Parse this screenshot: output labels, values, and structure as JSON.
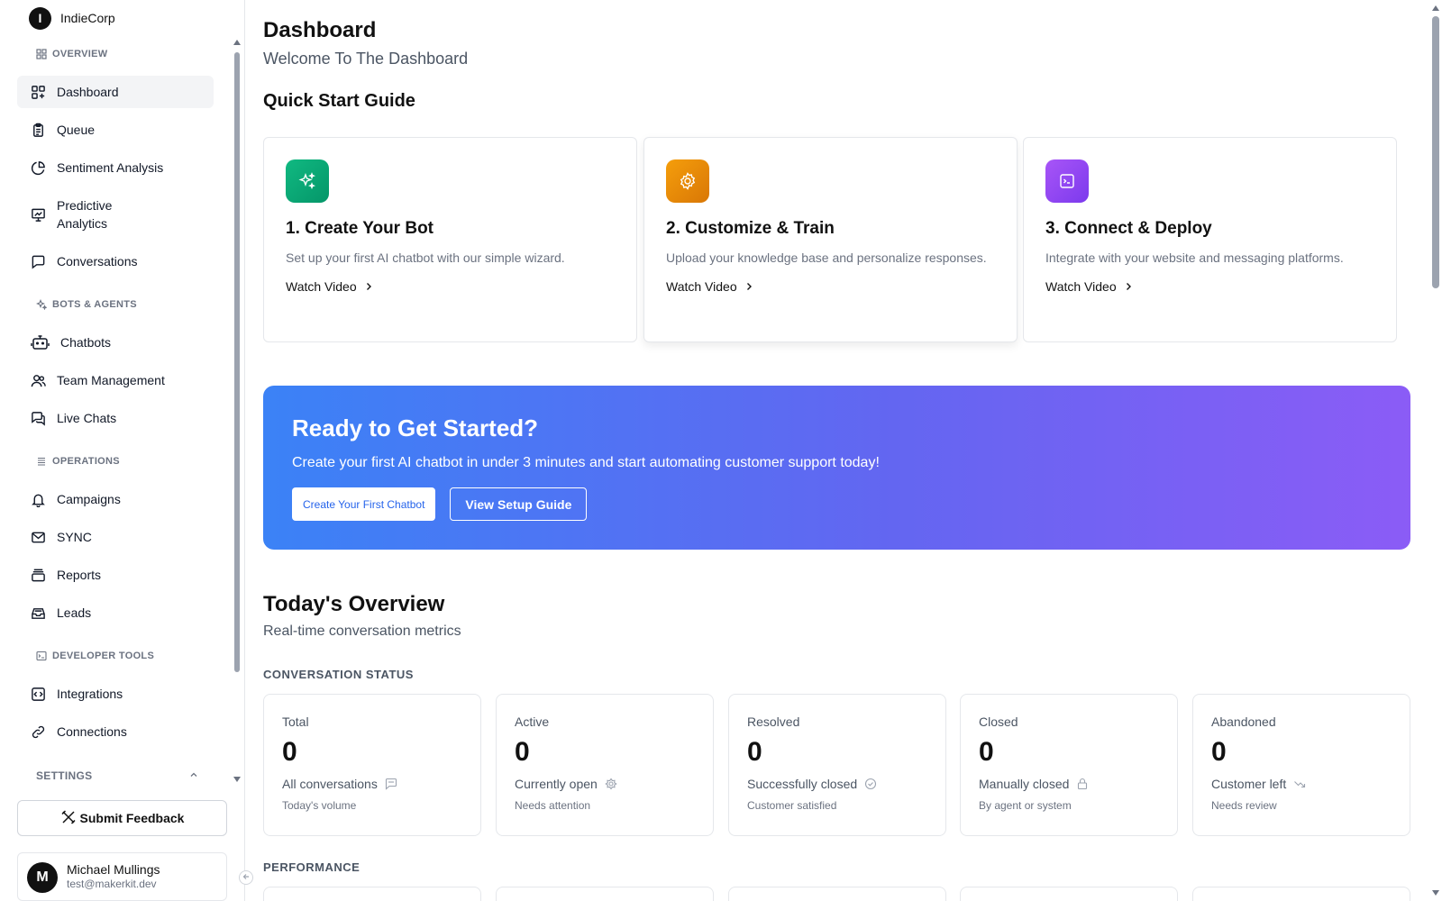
{
  "brand": {
    "logo_letter": "I",
    "name": "IndieCorp"
  },
  "sidebar": {
    "sections": {
      "overview": "OVERVIEW",
      "bots_agents": "BOTS & AGENTS",
      "operations": "OPERATIONS",
      "developer_tools": "DEVELOPER TOOLS",
      "settings": "SETTINGS"
    },
    "items": {
      "dashboard": "Dashboard",
      "queue": "Queue",
      "sentiment": "Sentiment Analysis",
      "predictive": "Predictive Analytics",
      "conversations": "Conversations",
      "chatbots": "Chatbots",
      "team": "Team Management",
      "live_chats": "Live Chats",
      "campaigns": "Campaigns",
      "sync": "SYNC",
      "reports": "Reports",
      "leads": "Leads",
      "integrations": "Integrations",
      "connections": "Connections"
    },
    "active_item": "dashboard",
    "feedback_button": "Submit Feedback"
  },
  "user": {
    "initial": "M",
    "name": "Michael Mullings",
    "email": "test@makerkit.dev"
  },
  "header": {
    "title": "Dashboard",
    "subtitle": "Welcome To The Dashboard"
  },
  "quick_start": {
    "title": "Quick Start Guide",
    "cards": [
      {
        "title": "1. Create Your Bot",
        "description": "Set up your first AI chatbot with our simple wizard.",
        "link": "Watch Video",
        "icon": "sparkles-icon",
        "color": "#10b981"
      },
      {
        "title": "2. Customize & Train",
        "description": "Upload your knowledge base and personalize responses.",
        "link": "Watch Video",
        "icon": "gear-icon",
        "color": "#f59e0b"
      },
      {
        "title": "3. Connect & Deploy",
        "description": "Integrate with your website and messaging platforms.",
        "link": "Watch Video",
        "icon": "terminal-icon",
        "color": "#8b5cf6"
      }
    ]
  },
  "banner": {
    "title": "Ready to Get Started?",
    "description": "Create your first AI chatbot in under 3 minutes and start automating customer support today!",
    "primary_button": "Create Your First Chatbot",
    "secondary_button": "View Setup Guide"
  },
  "overview": {
    "title": "Today's Overview",
    "subtitle": "Real-time conversation metrics",
    "status_label": "CONVERSATION STATUS",
    "performance_label": "PERFORMANCE",
    "metrics": [
      {
        "label": "Total",
        "value": "0",
        "desc": "All conversations",
        "sub": "Today's volume",
        "icon": "chat-icon"
      },
      {
        "label": "Active",
        "value": "0",
        "desc": "Currently open",
        "sub": "Needs attention",
        "icon": "live-icon"
      },
      {
        "label": "Resolved",
        "value": "0",
        "desc": "Successfully closed",
        "sub": "Customer satisfied",
        "icon": "check-circle-icon"
      },
      {
        "label": "Closed",
        "value": "0",
        "desc": "Manually closed",
        "sub": "By agent or system",
        "icon": "lock-icon"
      },
      {
        "label": "Abandoned",
        "value": "0",
        "desc": "Customer left",
        "sub": "Needs review",
        "icon": "trend-down-icon"
      }
    ]
  }
}
